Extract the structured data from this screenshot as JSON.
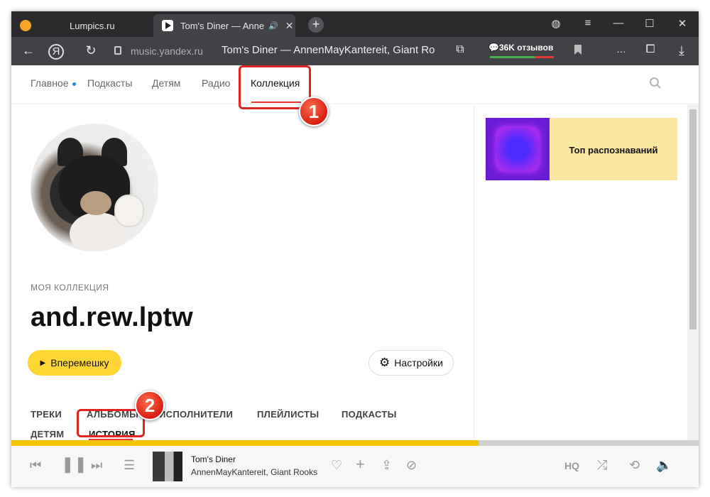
{
  "browser": {
    "tabs": [
      {
        "label": "Lumpics.ru",
        "active": false
      },
      {
        "label": "Tom's Diner — AnnenMayKantereit, Giant Rooks",
        "active": true
      }
    ],
    "address": {
      "host": "music.yandex.ru",
      "page_title": "Tom's Diner — AnnenMayKantereit, Giant Rooks"
    },
    "reviews_label": "36K отзывов"
  },
  "site_nav": {
    "items": [
      "Главное",
      "Подкасты",
      "Детям",
      "Радио",
      "Коллекция"
    ],
    "active": "Коллекция"
  },
  "profile": {
    "section_label": "МОЯ КОЛЛЕКЦИЯ",
    "username": "and.rew.lptw",
    "shuffle_label": "Вперемешку",
    "settings_label": "Настройки"
  },
  "collection_tabs": [
    "ТРЕКИ",
    "АЛЬБОМЫ",
    "ИСПОЛНИТЕЛИ",
    "ПЛЕЙЛИСТЫ",
    "ПОДКАСТЫ",
    "ДЕТЯМ",
    "ИСТОРИЯ"
  ],
  "active_collection_tab": "ИСТОРИЯ",
  "sidebar": {
    "banner_title": "Топ распознаваний"
  },
  "player": {
    "track_title": "Tom's Diner",
    "track_artist": "AnnenMayKantereit, Giant Rooks",
    "quality_label": "HQ",
    "progress_fraction": 0.68
  },
  "annotations": {
    "step1": "1",
    "step2": "2"
  },
  "colors": {
    "accent_yellow": "#ffd633",
    "annotation_red": "#e02424",
    "active_underline": "#e53935"
  }
}
